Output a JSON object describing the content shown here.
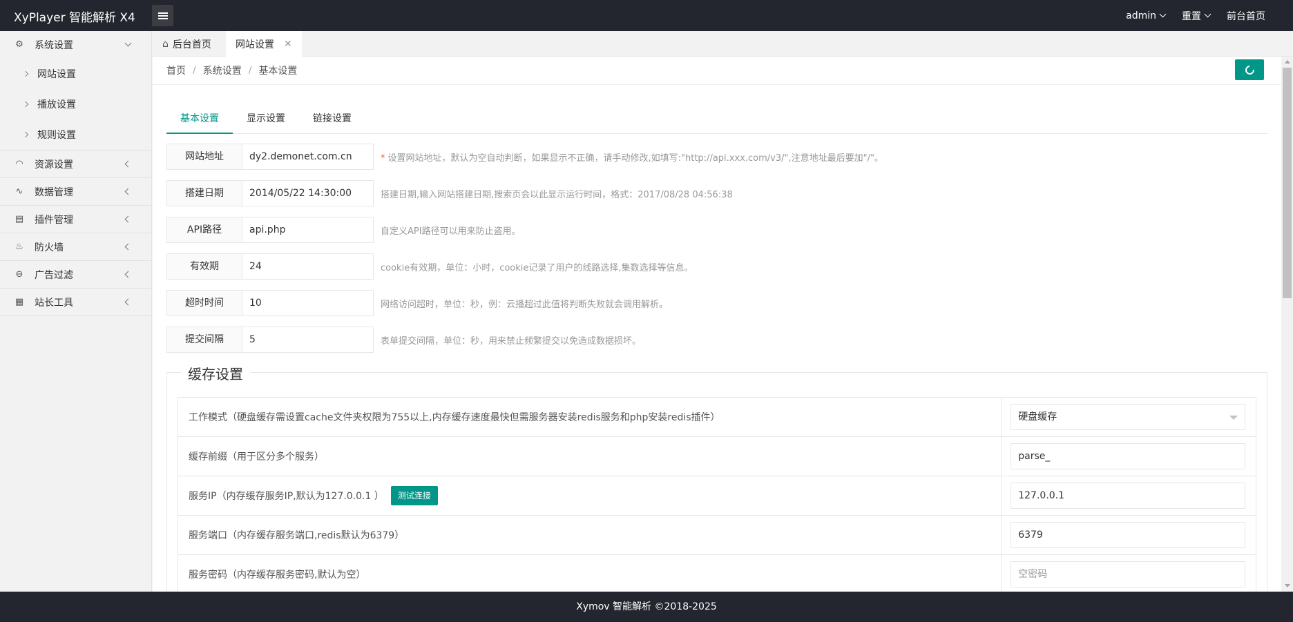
{
  "header": {
    "logo": "XyPlayer 智能解析 X4",
    "nav": [
      {
        "label": "admin",
        "has_dropdown": true
      },
      {
        "label": "重置",
        "has_dropdown": true
      },
      {
        "label": "前台首页",
        "has_dropdown": false
      }
    ]
  },
  "sidebar": {
    "system": {
      "label": "系统设置",
      "icon": "gear-icon",
      "children": [
        "网站设置",
        "播放设置",
        "规则设置"
      ]
    },
    "items": [
      {
        "label": "资源设置",
        "icon": "rss-icon"
      },
      {
        "label": "数据管理",
        "icon": "pulse-icon"
      },
      {
        "label": "插件管理",
        "icon": "plugin-icon"
      },
      {
        "label": "防火墙",
        "icon": "fire-icon"
      },
      {
        "label": "广告过滤",
        "icon": "minus-circle-icon"
      },
      {
        "label": "站长工具",
        "icon": "grid-icon"
      }
    ]
  },
  "tabs": {
    "home": "后台首页",
    "active": "网站设置",
    "close_glyph": "✕"
  },
  "breadcrumb": [
    "首页",
    "系统设置",
    "基本设置"
  ],
  "form_tabs": [
    "基本设置",
    "显示设置",
    "链接设置"
  ],
  "basic": [
    {
      "label": "网站地址",
      "value": "dy2.demonet.com.cn",
      "hint": "设置网站地址，默认为空自动判断，如果显示不正确，请手动修改,如填写:\"http://api.xxx.com/v3/\",注意地址最后要加\"/\"。",
      "required": true
    },
    {
      "label": "搭建日期",
      "value": "2014/05/22 14:30:00",
      "hint": "搭建日期,输入网站搭建日期,搜索页会以此显示运行时间，格式：2017/08/28 04:56:38",
      "required": false
    },
    {
      "label": "API路径",
      "value": "api.php",
      "hint": "自定义API路径可以用来防止盗用。",
      "required": false
    },
    {
      "label": "有效期",
      "value": "24",
      "hint": "cookie有效期，单位：小时，cookie记录了用户的线路选择,集数选择等信息。",
      "required": false
    },
    {
      "label": "超时时间",
      "value": "10",
      "hint": "网络访问超时，单位：秒，例：云播超过此值将判断失败就会调用解析。",
      "required": false
    },
    {
      "label": "提交间隔",
      "value": "5",
      "hint": "表单提交间隔，单位：秒，用来禁止频繁提交以免造成数据损坏。",
      "required": false
    }
  ],
  "cache": {
    "legend": "缓存设置",
    "rows": [
      {
        "label": "工作模式（硬盘缓存需设置cache文件夹权限为755以上,内存缓存速度最快但需服务器安装redis服务和php安装redis插件）",
        "value": "硬盘缓存"
      },
      {
        "label": "缓存前缀（用于区分多个服务）",
        "value": "parse_"
      },
      {
        "label": "服务IP（内存缓存服务IP,默认为127.0.0.1 ）",
        "value": "127.0.0.1",
        "button": "测试连接"
      },
      {
        "label": "服务端口（内存缓存服务端口,redis默认为6379）",
        "value": "6379"
      },
      {
        "label": "服务密码（内存缓存服务密码,默认为空）",
        "placeholder": "空密码"
      }
    ]
  },
  "footer": "Xymov 智能解析 ©2018-2025",
  "colors": {
    "accent": "#009688",
    "header_bg": "#23262e",
    "hint_required": "#ff5722"
  }
}
